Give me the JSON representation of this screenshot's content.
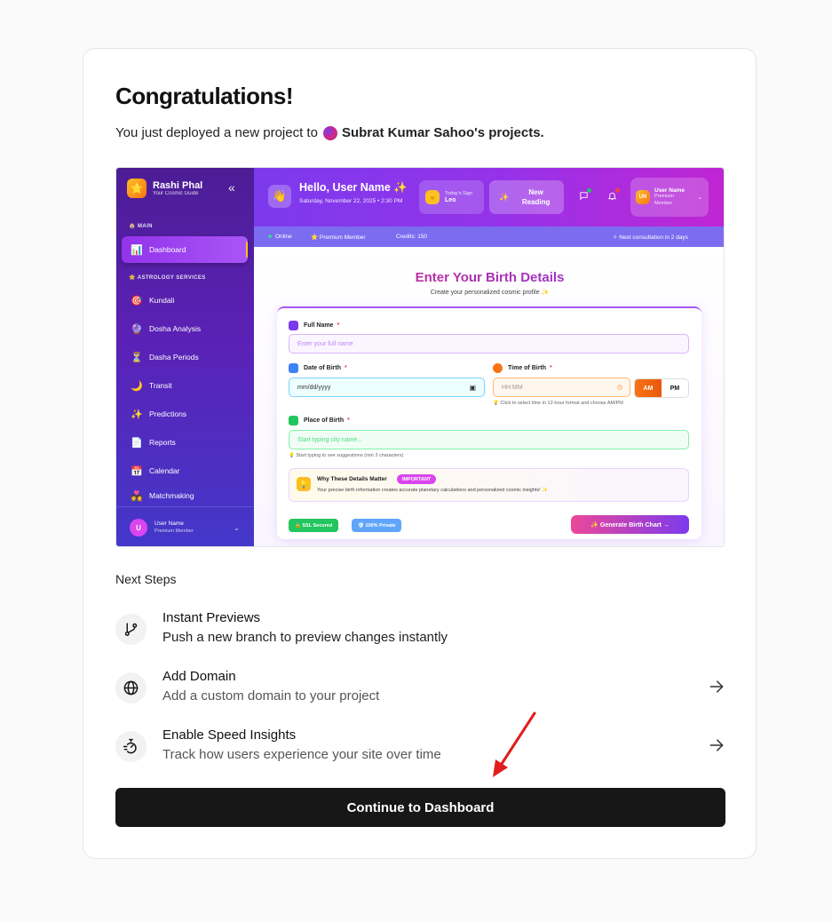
{
  "header": {
    "title": "Congratulations!",
    "subtitle_prefix": "You just deployed a new project to",
    "owner": "Subrat Kumar Sahoo's projects."
  },
  "preview": {
    "sidebar": {
      "brand_name": "Rashi Phal",
      "brand_tagline": "Your Cosmic Guide",
      "section_main": "🏠 MAIN",
      "section_services": "🌟 ASTROLOGY SERVICES",
      "items": [
        {
          "label": "Dashboard",
          "icon": "📊"
        },
        {
          "label": "Kundali",
          "icon": "🎯"
        },
        {
          "label": "Dosha Analysis",
          "icon": "🔮"
        },
        {
          "label": "Dasha Periods",
          "icon": "⏳"
        },
        {
          "label": "Transit",
          "icon": "🌙"
        },
        {
          "label": "Predictions",
          "icon": "✨"
        },
        {
          "label": "Reports",
          "icon": "📄"
        },
        {
          "label": "Calendar",
          "icon": "📅"
        },
        {
          "label": "Matchmaking",
          "icon": "💑"
        }
      ],
      "user_initial": "U",
      "user_name": "User Name",
      "user_role": "Premium Member"
    },
    "topbar": {
      "greeting": "Hello, User Name ✨",
      "date": "Saturday, November 22, 2025 • 2:30 PM",
      "sign_label": "Today's Sign",
      "sign_value": "Leo",
      "new_reading": "New Reading",
      "user_initials": "UN",
      "user_name": "User Name",
      "user_role": "Premium Member"
    },
    "status": {
      "online": "Online",
      "premium": "⭐ Premium Member",
      "credits": "Credits: 150",
      "next": "✧ Next consultation in 2 days"
    },
    "form": {
      "title": "Enter Your Birth Details",
      "subtitle": "Create your personalized cosmic profile ✨",
      "full_name_label": "Full Name",
      "full_name_placeholder": "Enter your full name",
      "dob_label": "Date of Birth",
      "dob_placeholder": "mm/dd/yyyy",
      "tob_label": "Time of Birth",
      "tob_placeholder": "HH:MM",
      "am": "AM",
      "pm": "PM",
      "tob_hint": "💡 Click to select time in 12-hour format and choose AM/PM",
      "pob_label": "Place of Birth",
      "pob_placeholder": "Start typing city name...",
      "pob_hint": "💡 Start typing to see suggestions (min 3 characters)",
      "why_title": "Why These Details Matter",
      "why_badge": "IMPORTANT",
      "why_text": "Your precise birth information creates accurate planetary calculations and personalized cosmic insights! ✨",
      "ssl": "🔒 SSL Secured",
      "private": "🛡 100% Private",
      "generate": "✨ Generate Birth Chart →"
    }
  },
  "next_steps": {
    "title": "Next Steps",
    "items": [
      {
        "name": "Instant Previews",
        "desc": "Push a new branch to preview changes instantly",
        "icon": "git-branch-icon"
      },
      {
        "name": "Add Domain",
        "desc": "Add a custom domain to your project",
        "icon": "globe-icon"
      },
      {
        "name": "Enable Speed Insights",
        "desc": "Track how users experience your site over time",
        "icon": "speed-insights-icon"
      }
    ]
  },
  "cta": {
    "label": "Continue to Dashboard"
  },
  "colors": {
    "cta_bg": "#171717",
    "annotation_arrow": "#e11d1d",
    "brand_purple": "#7c3aed"
  }
}
